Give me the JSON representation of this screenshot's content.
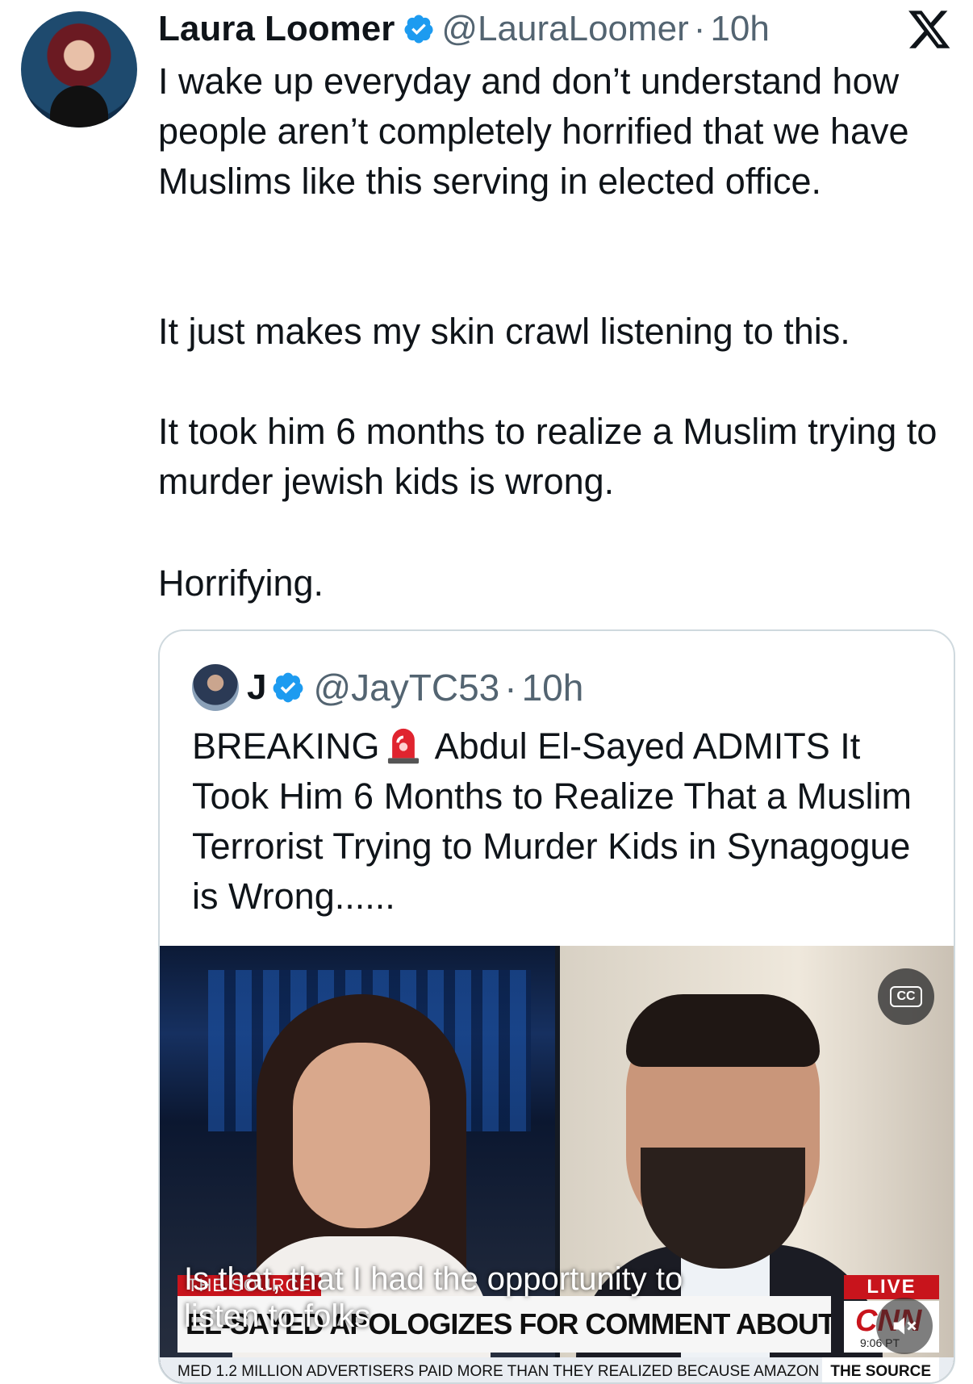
{
  "author": {
    "name": "Laura Loomer",
    "handle": "@LauraLoomer",
    "separator": "·",
    "time": "10h",
    "verified_color": "#1d9bf0"
  },
  "app_logo_icon": "x-logo-icon",
  "tweet": {
    "p1": "I wake up everyday and don’t understand how people aren’t completely horrified that we have Muslims like this serving in elected office.",
    "p2": "It just makes my skin crawl listening to this.",
    "p3": "It took him 6 months to realize a Muslim trying to murder jewish kids is wrong.",
    "p4": "Horrifying."
  },
  "quoted": {
    "name": "J",
    "handle": "@JayTC53",
    "separator": "·",
    "time": "10h",
    "text_before_emoji": "BREAKING",
    "emoji_icon": "siren-icon",
    "text_after_emoji": "Abdul El-Sayed ADMITS It Took Him 6 Months to Realize That a Muslim Terrorist Trying to Murder Kids in Synagogue is Wrong......",
    "video": {
      "cc_label": "CC",
      "source_tag": "THE SOURCE",
      "headline": "EL-SAYED APOLOGIZES FOR COMMENT ABOUT SYNAGOGUE ATTACK",
      "subtitle": "Is that, that I had the opportunity to listen to folks",
      "live_label": "LIVE",
      "network_logo": "CNN",
      "time_label": "9:06 PT",
      "ticker_text": "MED 1.2 MILLION ADVERTISERS PAID MORE THAN THEY REALIZED BECAUSE AMAZON",
      "ticker_source": "THE SOURCE"
    }
  }
}
